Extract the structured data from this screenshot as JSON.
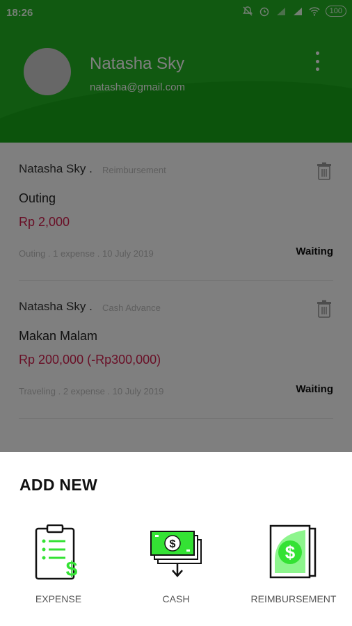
{
  "status_bar": {
    "time": "18:26",
    "battery": "100"
  },
  "profile": {
    "name": "Natasha Sky",
    "email": "natasha@gmail.com"
  },
  "requests": [
    {
      "requester": "Natasha Sky .",
      "type": "Reimbursement",
      "title": "Outing",
      "amount": "Rp 2,000",
      "meta": "Outing . 1 expense . 10 July 2019",
      "status": "Waiting"
    },
    {
      "requester": "Natasha Sky .",
      "type": "Cash Advance",
      "title": "Makan Malam",
      "amount": "Rp 200,000 (-Rp300,000)",
      "meta": "Traveling . 2 expense . 10 July 2019",
      "status": "Waiting"
    }
  ],
  "sheet": {
    "title": "ADD NEW",
    "options": [
      {
        "label": "EXPENSE",
        "icon": "clipboard-dollar-icon"
      },
      {
        "label": "CASH",
        "icon": "cash-stack-icon"
      },
      {
        "label": "REIMBURSEMENT",
        "icon": "document-dollar-icon"
      }
    ]
  },
  "colors": {
    "header_green": "#22b322",
    "accent_green": "#34e234",
    "amount_red": "#d3204f"
  }
}
